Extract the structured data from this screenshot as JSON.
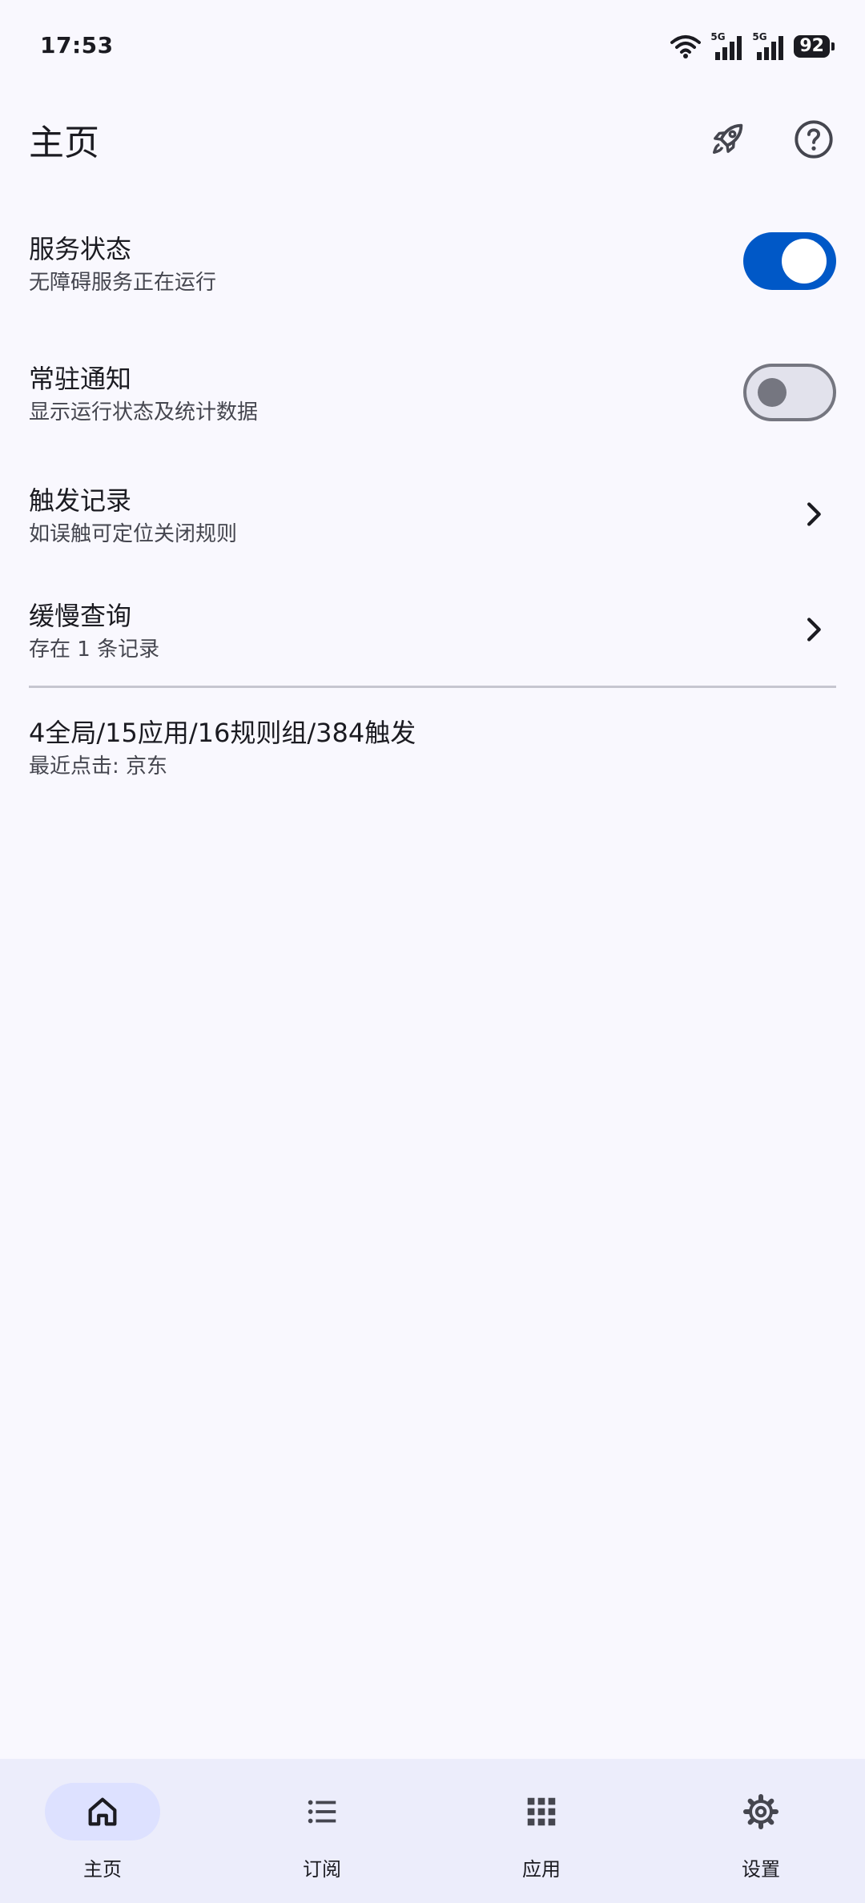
{
  "status_bar": {
    "time": "17:53",
    "sim1_tag": "5G",
    "sim2_tag": "5G",
    "battery": "92"
  },
  "header": {
    "title": "主页",
    "icons": [
      "rocket-icon",
      "help-circle-icon"
    ]
  },
  "settings": {
    "service_status": {
      "title": "服务状态",
      "subtitle": "无障碍服务正在运行",
      "enabled": true
    },
    "persistent_notification": {
      "title": "常驻通知",
      "subtitle": "显示运行状态及统计数据",
      "enabled": false
    },
    "trigger_log": {
      "title": "触发记录",
      "subtitle": "如误触可定位关闭规则"
    },
    "slow_query": {
      "title": "缓慢查询",
      "subtitle": "存在 1 条记录"
    }
  },
  "summary": {
    "stats": "4全局/15应用/16规则组/384触发",
    "last_click": "最近点击: 京东"
  },
  "bottom_nav": {
    "active_index": 0,
    "items": [
      {
        "label": "主页",
        "icon": "home-icon"
      },
      {
        "label": "订阅",
        "icon": "list-icon"
      },
      {
        "label": "应用",
        "icon": "apps-grid-icon"
      },
      {
        "label": "设置",
        "icon": "gear-icon"
      }
    ]
  },
  "colors": {
    "background": "#f9f8fe",
    "accent": "#0058c7",
    "nav_background": "#ecedfb",
    "nav_active_pill": "#dde1ff"
  }
}
